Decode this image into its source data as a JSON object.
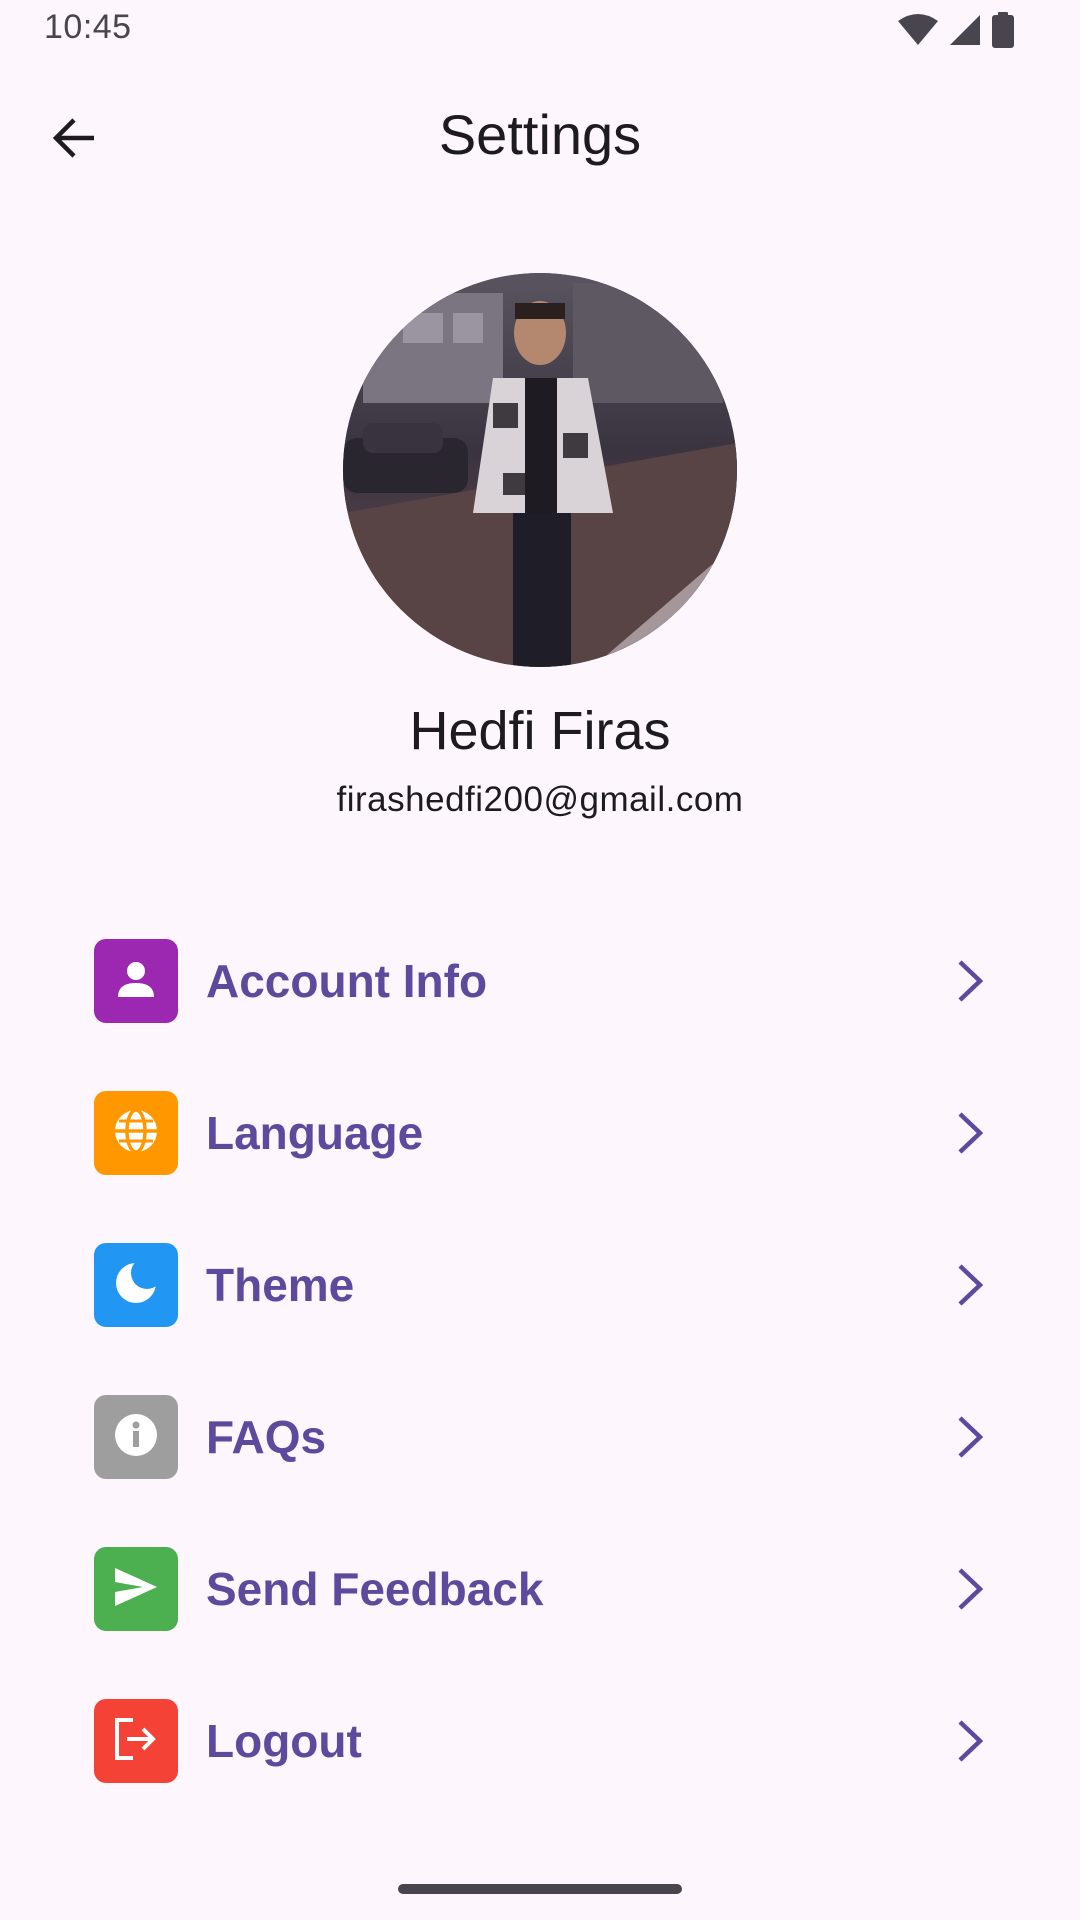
{
  "status_bar": {
    "time": "10:45",
    "icons": [
      "wifi-icon",
      "cellular-signal-icon",
      "battery-icon"
    ]
  },
  "app_bar": {
    "title": "Settings",
    "back_icon": "arrow-back-icon"
  },
  "profile": {
    "name": "Hedfi Firas",
    "email": "firashedfi200@gmail.com",
    "avatar": "profile-photo"
  },
  "menu": {
    "items": [
      {
        "label": "Account Info",
        "icon": "person-icon",
        "color": "#9c27b0"
      },
      {
        "label": "Language",
        "icon": "globe-icon",
        "color": "#ff9800"
      },
      {
        "label": "Theme",
        "icon": "moon-icon",
        "color": "#2196f3"
      },
      {
        "label": "FAQs",
        "icon": "info-icon",
        "color": "#9e9e9e"
      },
      {
        "label": "Send Feedback",
        "icon": "send-icon",
        "color": "#4caf50"
      },
      {
        "label": "Logout",
        "icon": "logout-icon",
        "color": "#f44336"
      }
    ]
  },
  "colors": {
    "background": "#fdf6fd",
    "label": "#5d4a9d",
    "chevron": "#5d4a9d"
  }
}
